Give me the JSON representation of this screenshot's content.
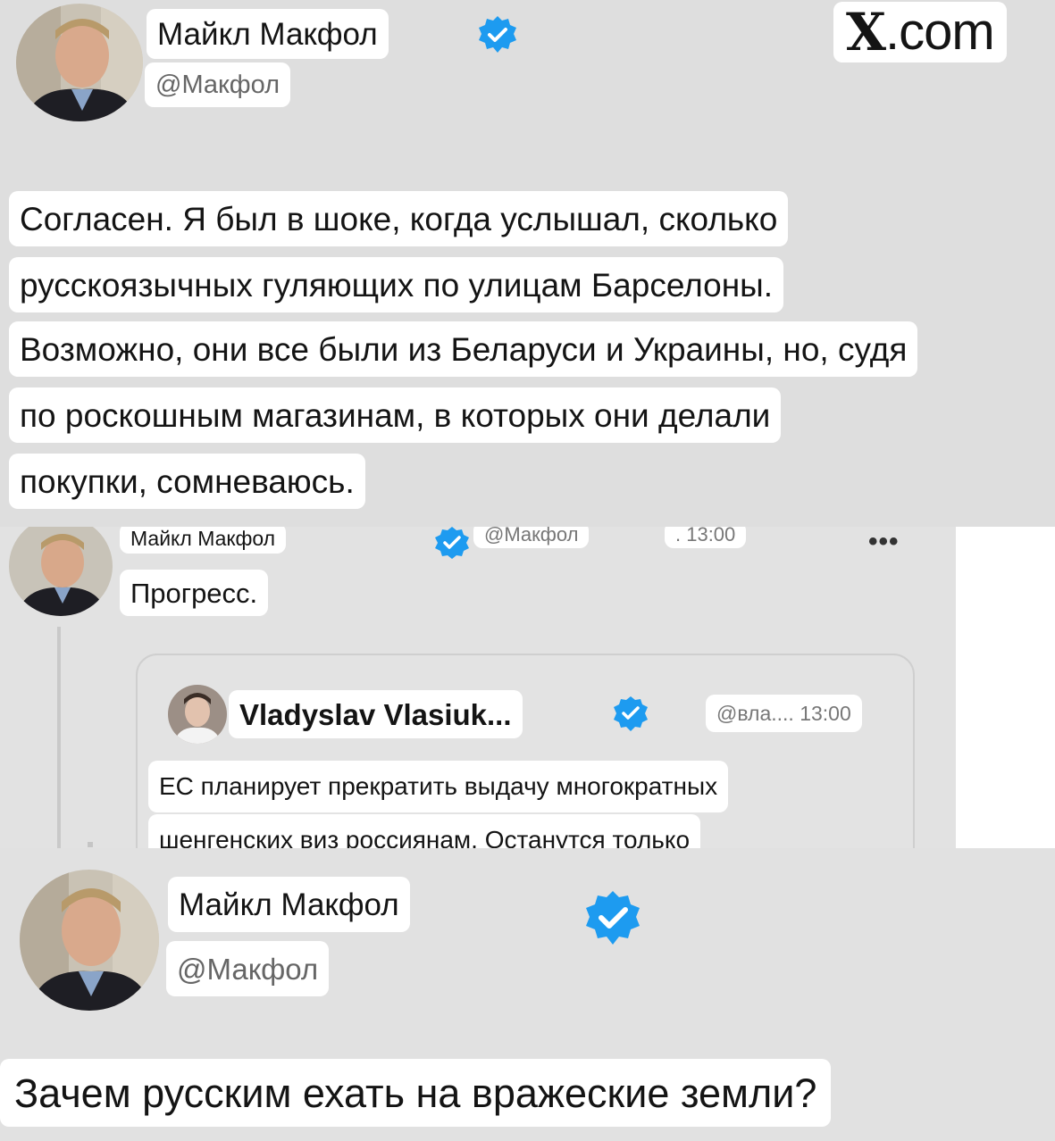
{
  "post1": {
    "author_name": "Майкл Макфол",
    "author_handle": "@Макфол",
    "site_label_x": "X",
    "site_label_rest": ".com",
    "lines": [
      "Согласен. Я был в шоке, когда услышал, сколько",
      "русскоязычных гуляющих по улицам Барселоны.",
      "Возможно, они все были из Беларуси и Украины, но, судя",
      "по роскошным магазинам, в которых они делали",
      "покупки, сомневаюсь."
    ]
  },
  "post2": {
    "author_name": "Майкл Макфол",
    "author_handle": "@Макфол",
    "time": ". 13:00",
    "more": "•••",
    "text": "Прогресс.",
    "quote": {
      "author_name": "Vladyslav Vlasiuk...",
      "handle_time": "@вла.... 13:00",
      "lines": [
        "ЕС планирует прекратить выдачу многократных",
        "шенгенских виз россиянам. Останутся только"
      ]
    }
  },
  "post3": {
    "author_name": "Майкл Макфол",
    "author_handle": "@Макфол",
    "text": "Зачем русским ехать на вражеские земли?"
  },
  "icons": {
    "verified": "verified-badge-icon",
    "more": "more-options-icon"
  },
  "colors": {
    "verified_blue": "#1d9bf0",
    "highlight_bg": "#ffffff",
    "panel_bg": "#e0e0e0"
  }
}
